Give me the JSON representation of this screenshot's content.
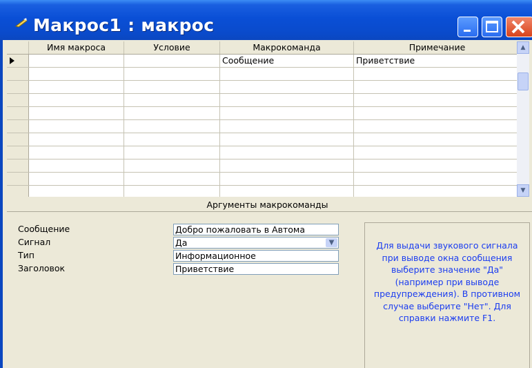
{
  "window": {
    "title": "Макрос1 : макрос",
    "icon": "macro-icon"
  },
  "title_buttons": {
    "minimize": "minimize-icon",
    "maximize": "maximize-icon",
    "close": "close-icon"
  },
  "grid": {
    "columns": [
      "Имя макроса",
      "Условие",
      "Макрокоманда",
      "Примечание"
    ],
    "rows": [
      [
        "",
        "",
        "Сообщение",
        "Приветствие"
      ],
      [
        "",
        "",
        "",
        ""
      ],
      [
        "",
        "",
        "",
        ""
      ],
      [
        "",
        "",
        "",
        ""
      ],
      [
        "",
        "",
        "",
        ""
      ],
      [
        "",
        "",
        "",
        ""
      ],
      [
        "",
        "",
        "",
        ""
      ],
      [
        "",
        "",
        "",
        ""
      ],
      [
        "",
        "",
        "",
        ""
      ],
      [
        "",
        "",
        "",
        ""
      ],
      [
        "",
        "",
        "",
        ""
      ]
    ],
    "current_row": 0
  },
  "arguments": {
    "title": "Аргументы макрокоманды",
    "fields": [
      {
        "label": "Сообщение",
        "value": "Добро пожаловать в Автома"
      },
      {
        "label": "Сигнал",
        "value": "Да"
      },
      {
        "label": "Тип",
        "value": "Информационное"
      },
      {
        "label": "Заголовок",
        "value": "Приветствие"
      }
    ]
  },
  "help": {
    "text": "Для выдачи звукового сигнала при выводе окна сообщения выберите значение \"Да\" (например при выводе предупреждения).  В противном случае выберите \"Нет\".  Для справки нажмите F1."
  },
  "colors": {
    "titlebar": "#0a4fd6",
    "window_bg": "#ece9d8",
    "help_text": "#1a3cf0",
    "close_button": "#d8431b"
  }
}
